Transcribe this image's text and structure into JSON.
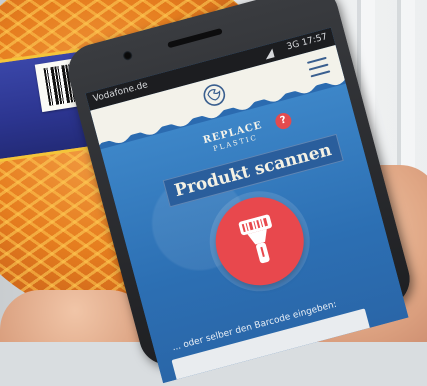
{
  "status_bar": {
    "carrier": "Vodafone.de",
    "right": "3G 17:57"
  },
  "header": {
    "logo_icon": "recycle-globe-icon",
    "menu_icon": "hamburger-menu-icon"
  },
  "brand": {
    "line1": "REPLACE",
    "line2": "PLASTIC"
  },
  "help_badge": "?",
  "main": {
    "title": "Produkt scannen",
    "scan_icon": "barcode-scanner-icon",
    "barcode_hint": "... oder selber den Barcode eingeben:"
  },
  "colors": {
    "accent": "#e8484d",
    "primary": "#2c6fb3",
    "appbar": "#f3f2ea"
  }
}
